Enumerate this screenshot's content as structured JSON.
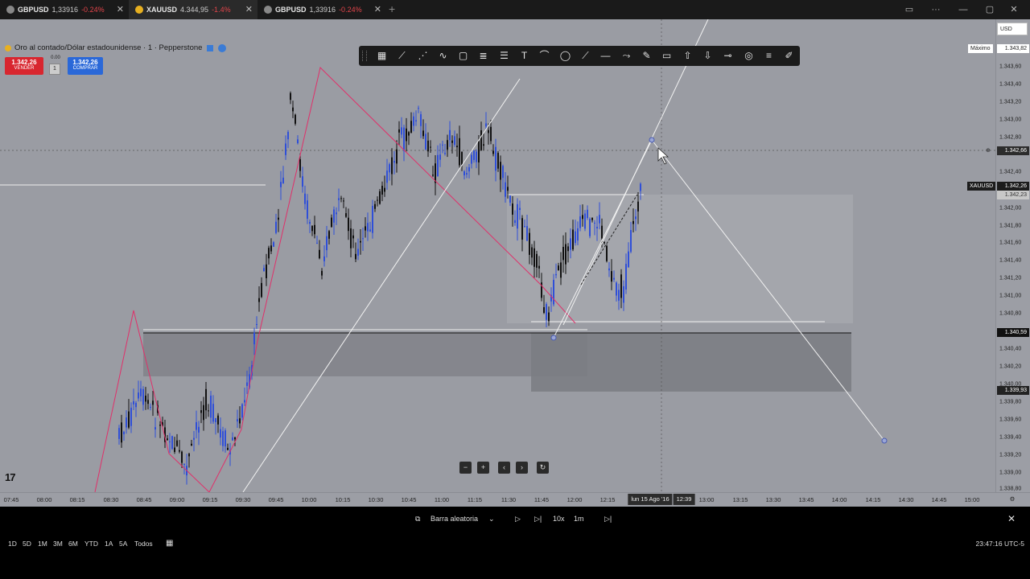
{
  "tabs": [
    {
      "symbol": "GBPUSD",
      "price": "1,33916",
      "change": "-0.24%"
    },
    {
      "symbol": "XAUUSD",
      "price": "4.344,95",
      "change": "-1.4%"
    },
    {
      "symbol": "GBPUSD",
      "price": "1,33916",
      "change": "-0.24%"
    }
  ],
  "symbol_title": "Oro al contado/Dólar estadounidense · 1 · Pepperstone",
  "trade": {
    "sell_price": "1.342,26",
    "sell_label": "VENDER",
    "buy_price": "1.342,26",
    "buy_label": "COMPRAR",
    "spread": "0.00",
    "qty": "1"
  },
  "currency": "USD",
  "maximo_label": "Máximo",
  "price_labels": {
    "maximo": "1.343,82",
    "crosshair": "1.342,66",
    "xauusd_tag": "XAUUSD",
    "xauusd": "1.342,26",
    "below_xau": "1.342,23",
    "level1": "1.340,59",
    "level2": "1.339,93"
  },
  "y_ticks": [
    "1.343,60",
    "1.343,40",
    "1.343,20",
    "1.343,00",
    "1.342,80",
    "1.342,40",
    "1.342,00",
    "1.341,80",
    "1.341,60",
    "1.341,40",
    "1.341,20",
    "1.341,00",
    "1.340,80",
    "1.340,40",
    "1.340,20",
    "1.340,00",
    "1.339,80",
    "1.339,60",
    "1.339,40",
    "1.339,20",
    "1.339,00",
    "1.338,80"
  ],
  "x_ticks": [
    "07:45",
    "08:00",
    "08:15",
    "08:30",
    "08:45",
    "09:00",
    "09:15",
    "09:30",
    "09:45",
    "10:00",
    "10:15",
    "10:30",
    "10:45",
    "11:00",
    "11:15",
    "11:30",
    "11:45",
    "12:00",
    "12:15",
    "13:00",
    "13:15",
    "13:30",
    "13:45",
    "14:00",
    "14:15",
    "14:30",
    "14:45",
    "15:00"
  ],
  "x_cursor_date": "lun 15 Ago '16",
  "x_cursor_time": "12:39",
  "replay": {
    "mode": "Barra aleatoria",
    "speed": "10x",
    "interval": "1m"
  },
  "ranges": [
    "1D",
    "5D",
    "1M",
    "3M",
    "6M",
    "YTD",
    "1A",
    "5A",
    "Todos"
  ],
  "clock": "23:47:16 UTC-5",
  "logo": "17",
  "colors": {
    "chart_bg": "#9a9ca3",
    "bull": "#2f4fd8",
    "bear": "#111111",
    "pink": "#e0306a",
    "sell": "#d8262f",
    "buy": "#2a68d8"
  }
}
